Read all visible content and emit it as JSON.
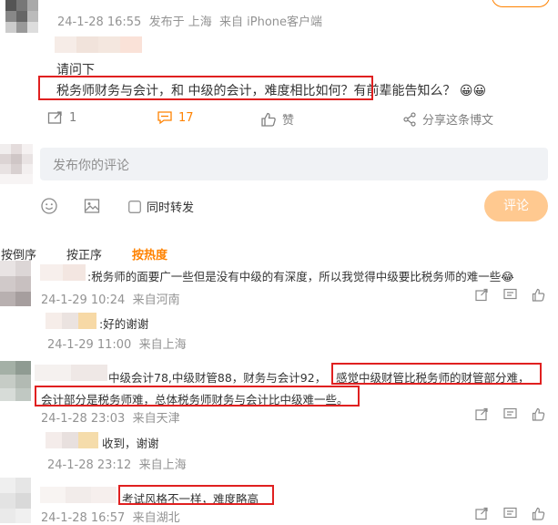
{
  "post": {
    "time": "24-1-28 16:55",
    "location": "发布于 上海",
    "source": "来自 iPhone客户端",
    "line1": "请问下",
    "line2_boxed": "税务师财务与会计，和 中级的会计，难度相比如何？",
    "line2_tail": "有前辈能告知么？",
    "emoji": "😀😀",
    "actions": {
      "forward_count": "1",
      "comment_count": "17",
      "like_label": "赞",
      "share_label": "分享这条博文"
    }
  },
  "composer": {
    "placeholder": "发布你的评论",
    "repost_label": "同时转发",
    "submit_label": "评论"
  },
  "sort_tabs": {
    "reverse": "按倒序",
    "forward": "按正序",
    "hot": "按热度"
  },
  "comments": [
    {
      "text": ":税务师的面要广一些但是没有中级的有深度，所以我觉得中级要比税务师的难一些",
      "emoji": "😂",
      "time": "24-1-29 10:24",
      "source": "来自河南",
      "reply": {
        "text": ":好的谢谢",
        "time": "24-1-29 11:00",
        "source": "来自上海"
      }
    },
    {
      "text_plain": "中级会计78,中级财管88，财务与会计92，",
      "text_boxed_1": "感觉中级财管比税务师的财管部分难，",
      "text_boxed_2": "会计部分是税务师难，总体税务师财务与会计比中级难一些。",
      "time": "24-1-28 23:03",
      "source": "来自天津",
      "reply": {
        "text": "收到，谢谢",
        "time": "24-1-28 23:12",
        "source": "来自上海"
      }
    },
    {
      "text_boxed": "考试风格不一样，难度略高",
      "time": "24-1-28 16:57",
      "source": "来自湖北"
    }
  ],
  "colors": {
    "accent": "#ff8200",
    "hot_tab": "#ff8200",
    "red_box": "#e02020",
    "meta": "#939393",
    "submit_bg": "#ffc990"
  },
  "icons": [
    "forward-icon",
    "comment-icon",
    "like-icon",
    "share-icon",
    "emoji-icon",
    "image-icon",
    "checkbox-icon"
  ]
}
